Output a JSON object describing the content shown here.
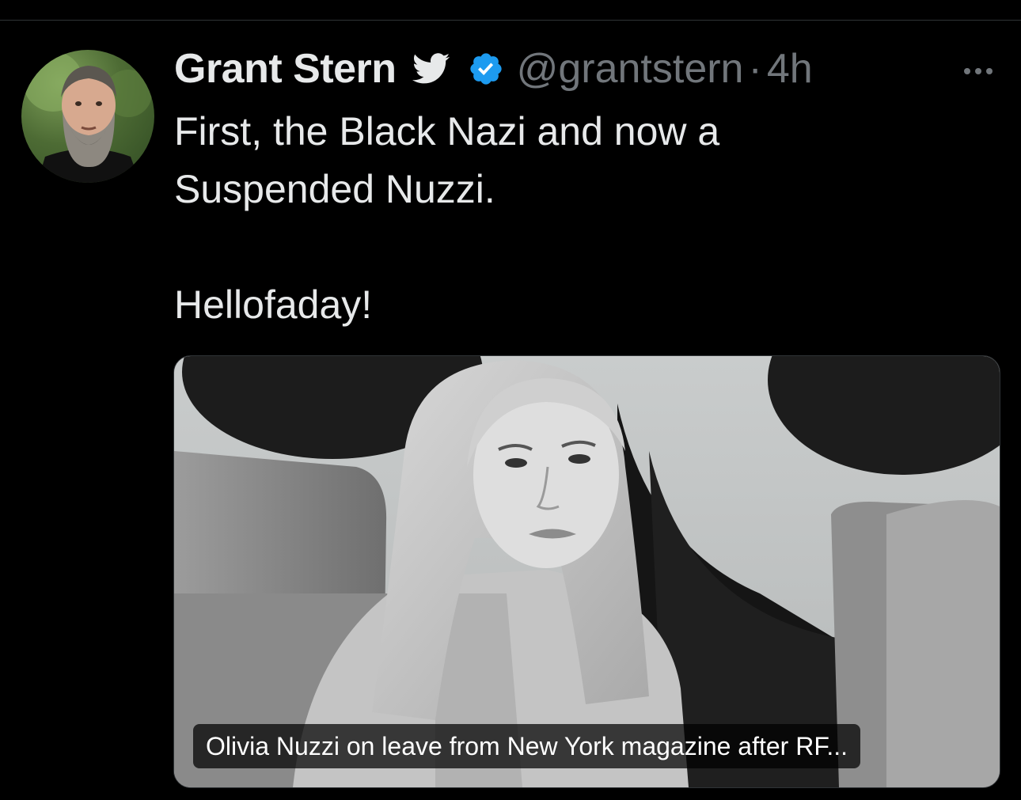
{
  "tweet": {
    "author": {
      "display_name": "Grant Stern",
      "handle": "@grantstern",
      "badges": [
        "bird-icon",
        "verified-icon"
      ],
      "verified_color": "#1d9bf0"
    },
    "separator": "·",
    "time": "4h",
    "text_lines": [
      "First, the Black Nazi and now a",
      "Suspended Nuzzi.",
      "",
      "Hellofaday!"
    ],
    "media": {
      "caption": "Olivia Nuzzi on leave from New York magazine after RF..."
    }
  },
  "colors": {
    "background": "#000000",
    "text": "#e7e9ea",
    "secondary_text": "#71767b",
    "divider": "#2f3336"
  }
}
